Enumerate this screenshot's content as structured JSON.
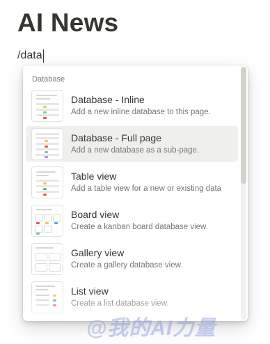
{
  "page": {
    "title": "AI News",
    "command_text": "/data"
  },
  "menu": {
    "section_label": "Database",
    "items": [
      {
        "title": "Database - Inline",
        "desc": "Add a new inline database to this page.",
        "icon": "inline-database-icon",
        "active": false
      },
      {
        "title": "Database - Full page",
        "desc": "Add a new database as a sub-page.",
        "icon": "full-page-database-icon",
        "active": true
      },
      {
        "title": "Table view",
        "desc": "Add a table view for a new or existing data",
        "icon": "table-view-icon",
        "active": false
      },
      {
        "title": "Board view",
        "desc": "Create a kanban board database view.",
        "icon": "board-view-icon",
        "active": false
      },
      {
        "title": "Gallery view",
        "desc": "Create a gallery database view.",
        "icon": "gallery-view-icon",
        "active": false
      },
      {
        "title": "List view",
        "desc": "Create a list database view.",
        "icon": "list-view-icon",
        "active": false
      }
    ]
  },
  "watermark": {
    "text": "@我的AI力量"
  },
  "colors": {
    "text": "#37352f",
    "muted": "#787774",
    "hover_bg": "#efefee",
    "tag_yellow": "#f2c94c",
    "tag_red": "#eb5757",
    "tag_green": "#6fcf97",
    "tag_blue": "#56a3f0",
    "tag_purple": "#bb87fc"
  }
}
